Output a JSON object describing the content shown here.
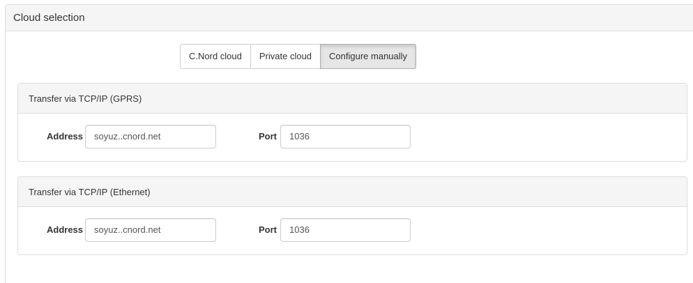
{
  "panel": {
    "title": "Cloud selection"
  },
  "cloud_options": {
    "items": [
      "C.Nord cloud",
      "Private cloud",
      "Configure manually"
    ],
    "selected": "Configure manually"
  },
  "gprs": {
    "title": "Transfer via TCP/IP (GPRS)",
    "address_label": "Address",
    "address_value": "soyuz..cnord.net",
    "port_label": "Port",
    "port_value": "1036"
  },
  "ethernet": {
    "title": "Transfer via TCP/IP (Ethernet)",
    "address_label": "Address",
    "address_value": "soyuz..cnord.net",
    "port_label": "Port",
    "port_value": "1036"
  },
  "colors": {
    "heading_bg": "#f5f5f5",
    "border": "#dddddd",
    "active_button_bg": "#e6e6e6",
    "text": "#333333"
  }
}
